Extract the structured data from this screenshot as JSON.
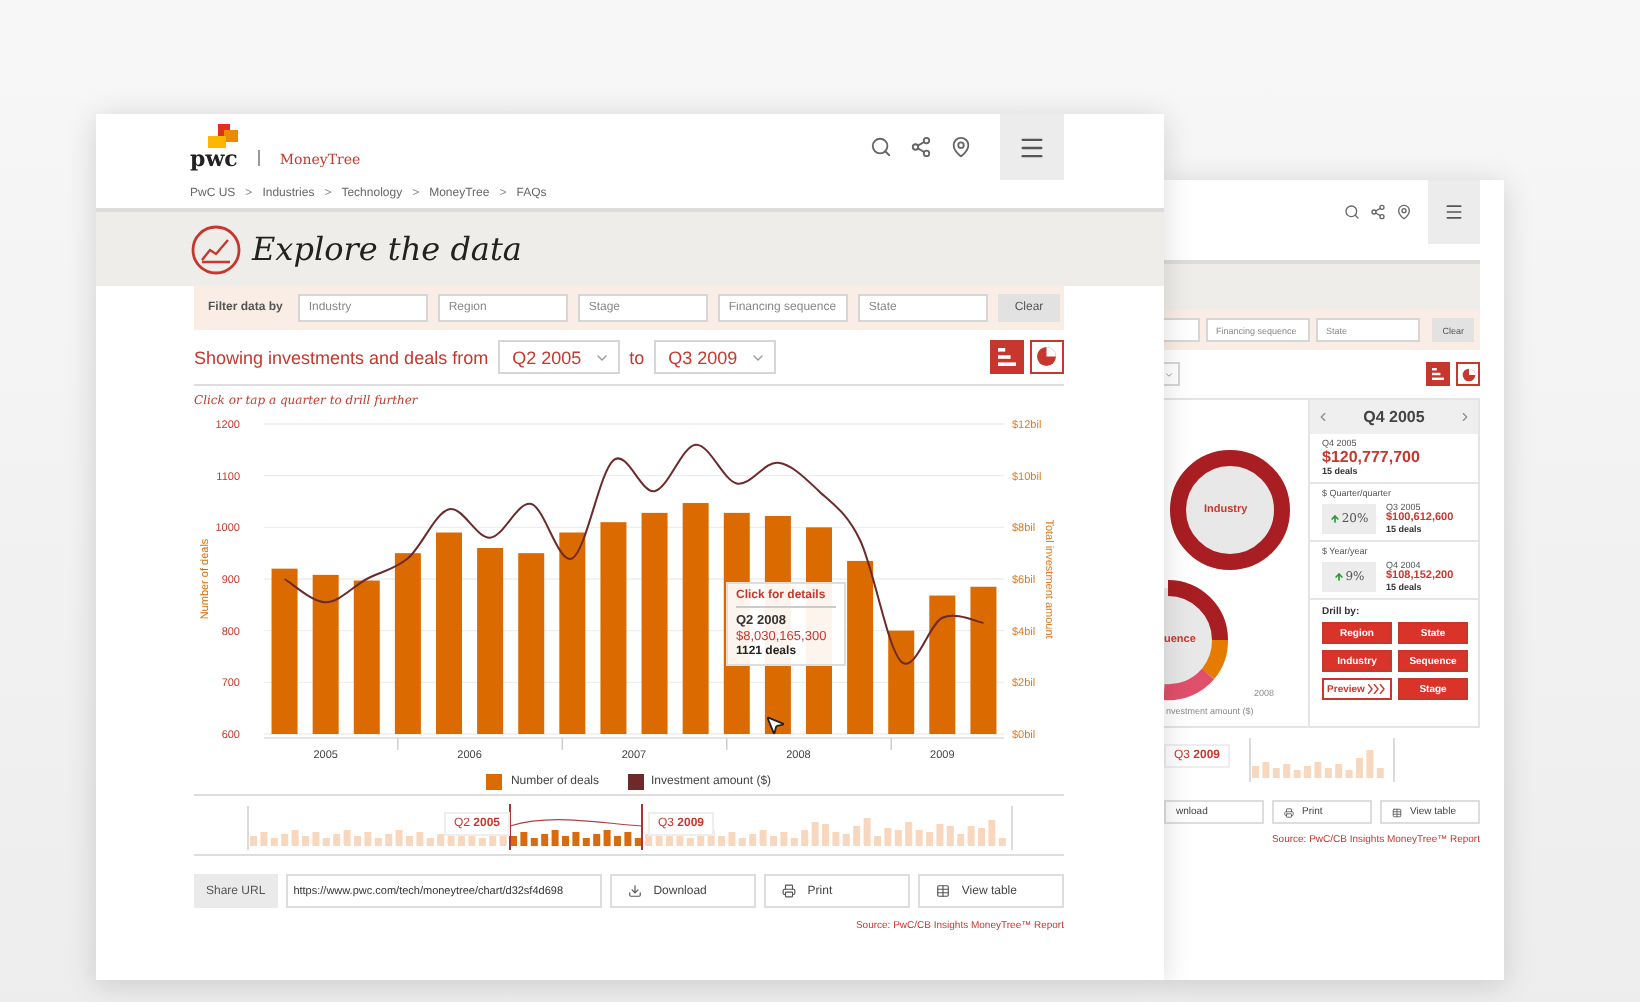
{
  "front_window": {
    "logo": {
      "brand": "pwc",
      "product": "MoneyTree"
    },
    "breadcrumb": {
      "separator": ">",
      "items": [
        "PwC US",
        "Industries",
        "Technology",
        "MoneyTree",
        "FAQs"
      ]
    },
    "title": "Explore the data",
    "filter": {
      "label": "Filter data by",
      "fields": [
        {
          "placeholder": "Industry"
        },
        {
          "placeholder": "Region"
        },
        {
          "placeholder": "Stage"
        },
        {
          "placeholder": "Financing sequence"
        },
        {
          "placeholder": "State"
        }
      ],
      "clear": "Clear"
    },
    "range": {
      "prefix": "Showing investments and deals from",
      "from": "Q2 2005",
      "joiner": "to",
      "to": "Q3 2009"
    },
    "view_toggles": [
      {
        "kind": "bars",
        "selected": true
      },
      {
        "kind": "pie",
        "selected": false
      }
    ],
    "hint": "Click or tap a quarter to drill further",
    "chart_data": {
      "type": "bar",
      "ylabel": "Number of deals",
      "y2label": "Total investment amount",
      "x": [
        2005.25,
        2005.5,
        2005.75,
        2006,
        2006.25,
        2006.5,
        2006.75,
        2007,
        2007.25,
        2007.5,
        2007.75,
        2008,
        2008.25,
        2008.5,
        2008.75,
        2009,
        2009.25,
        2009.5
      ],
      "series": [
        {
          "name": "Number of deals",
          "color": "#db6b00",
          "type": "bar",
          "values": [
            920,
            908,
            897,
            950,
            990,
            960,
            950,
            990,
            1010,
            1028,
            1047,
            1028,
            1022,
            1000,
            935,
            800,
            868,
            885
          ]
        },
        {
          "name": "Investment amount ($)",
          "color": "#6e2a2a",
          "type": "line",
          "axis": "y2",
          "values": [
            6.0,
            5.1,
            6.0,
            6.8,
            8.7,
            7.6,
            8.9,
            6.8,
            10.6,
            9.4,
            11.2,
            9.7,
            10.5,
            9.4,
            7.5,
            2.8,
            4.5,
            4.3
          ]
        }
      ],
      "ylim": [
        600,
        1200
      ],
      "yticks": [
        600,
        700,
        800,
        900,
        1000,
        1100,
        1200
      ],
      "y2lim": [
        0,
        12
      ],
      "y2ticks": [
        {
          "value": 0,
          "label": "$0bil"
        },
        {
          "value": 2,
          "label": "$2bil"
        },
        {
          "value": 4,
          "label": "$4bil"
        },
        {
          "value": 6,
          "label": "$6bil"
        },
        {
          "value": 8,
          "label": "$8bil"
        },
        {
          "value": 10,
          "label": "$10bil"
        },
        {
          "value": 12,
          "label": "$12bil"
        }
      ],
      "xlim": [
        2005.125,
        2009.625
      ],
      "grid": true,
      "xticks": [
        {
          "value": 2005.5,
          "label": "2005"
        },
        {
          "value": 2006.375,
          "label": "2006"
        },
        {
          "value": 2007.375,
          "label": "2007"
        },
        {
          "value": 2008.375,
          "label": "2008"
        },
        {
          "value": 2009.25,
          "label": "2009"
        }
      ]
    },
    "tooltip": {
      "heading": "Click for details",
      "quarter": "Q2 2008",
      "amount": "$8,030,165,300",
      "deals": "1121 deals"
    },
    "timeline": {
      "from_label": "Q2 **2005**",
      "to_label": "Q3 **2009**"
    },
    "share": {
      "label": "Share URL",
      "url": "https://www.pwc.com/tech/moneytree/chart/d32sf4d698",
      "actions": [
        {
          "kind": "download",
          "label": "Download"
        },
        {
          "kind": "print",
          "label": "Print"
        },
        {
          "kind": "table",
          "label": "View table"
        }
      ]
    },
    "source": "Source: PwC/CB Insights MoneyTree™ Report"
  },
  "back_window": {
    "filter": {
      "fields": [
        {
          "kind": "partial"
        },
        {
          "placeholder": "Financing sequence"
        },
        {
          "placeholder": "State"
        }
      ],
      "clear": "Clear"
    },
    "view_toggles": [
      {
        "kind": "bars",
        "selected": true
      },
      {
        "kind": "pie",
        "selected": false
      }
    ],
    "donut_labels": [
      "Industry",
      "uence"
    ],
    "faint_texts": [
      "2008",
      "nvestment amount ($)"
    ],
    "detail": {
      "quarter": "Q4 2005",
      "summary": {
        "quarter": "Q4 2005",
        "amount": "$120,777,700",
        "deals": "15 deals"
      },
      "comparisons": [
        {
          "label": "$ Quarter/quarter",
          "increase": true,
          "change": "20%",
          "quarter": "Q3 2005",
          "amount": "$100,612,600",
          "deals": "15 deals"
        },
        {
          "label": "$ Year/year",
          "increase": true,
          "change": "9%",
          "quarter": "Q4 2004",
          "amount": "$108,152,200",
          "deals": "15 deals"
        }
      ],
      "drill_label": "Drill by:",
      "drill_buttons": [
        {
          "kind": "filled",
          "label": "Region"
        },
        {
          "kind": "filled",
          "label": "State"
        },
        {
          "kind": "filled",
          "label": "Industry"
        },
        {
          "kind": "filled",
          "label": "Sequence"
        },
        {
          "kind": "preview",
          "label": "Preview"
        },
        {
          "kind": "filled",
          "label": "Stage"
        }
      ]
    },
    "timeline": {
      "to_label": "Q3 **2009**"
    },
    "actions": [
      {
        "kind": "partial",
        "label": "wnload"
      },
      {
        "kind": "print",
        "label": "Print"
      },
      {
        "kind": "table",
        "label": "View table"
      }
    ],
    "source": "Source: PwC/CB Insights MoneyTree™ Report"
  }
}
